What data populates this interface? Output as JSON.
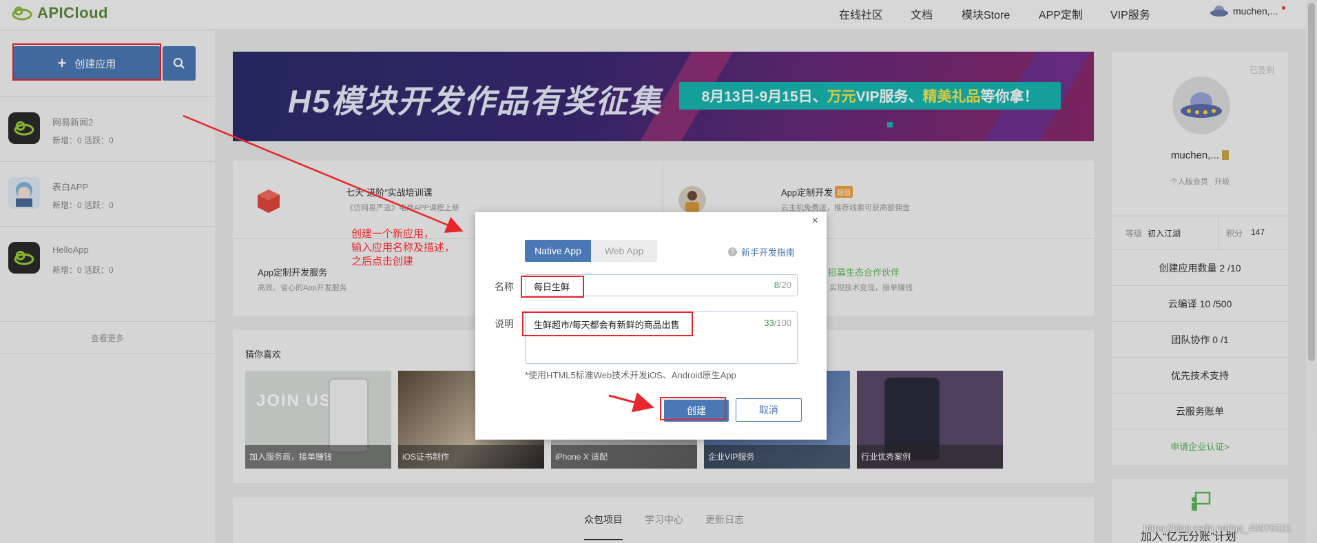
{
  "header": {
    "logo_text": "APICloud",
    "nav": [
      "在线社区",
      "文档",
      "模块Store",
      "APP定制",
      "VIP服务"
    ],
    "username": "muchen,..."
  },
  "sidebar": {
    "create_label": "创建应用",
    "apps": [
      {
        "name": "网易新闻2",
        "stats": "新增：0   活跃：0"
      },
      {
        "name": "表白APP",
        "stats": "新增：0   活跃：0"
      },
      {
        "name": "HelloApp",
        "stats": "新增：0   活跃：0"
      }
    ],
    "see_more": "查看更多"
  },
  "banner": {
    "title": "H5模块开发作品有奖征集",
    "pill_a": "8月13日-9月15日、",
    "pill_b": "万元",
    "pill_c": "VIP服务、",
    "pill_d": "精美礼品",
    "pill_e": "等你拿！"
  },
  "promos": [
    {
      "title": "七天“进阶”实战培训课",
      "sub": "《仿网易严选》电商APP课程上新"
    },
    {
      "title": "App定制开发",
      "tag": "超值",
      "sub": "云主机免费送，推荐线索可获高额佣金"
    },
    {
      "title": "App定制开发服务",
      "sub": "高效、省心的App开发服务"
    },
    {
      "title": "招募生态合作伙伴",
      "sub": "实现技术变现，接单赚钱"
    }
  ],
  "guess": {
    "label": "猜你喜欢",
    "items": [
      "加入服务商，接单赚钱",
      "iOS证书制作",
      "iPhone X 适配",
      "企业VIP服务",
      "行业优秀案例"
    ],
    "join_us": "JOIN US"
  },
  "bottom_tabs": [
    "众包项目",
    "学习中心",
    "更新日志"
  ],
  "profile": {
    "signed": "已签到",
    "name": "muchen,...",
    "edition": "个人版会员",
    "upgrade": "升级",
    "level_label": "等级",
    "level_value": "初入江湖",
    "points_label": "积分",
    "points_value": "147",
    "rows": [
      "创建应用数量 2 /10",
      "云编译 10 /500",
      "团队协作 0 /1",
      "优先技术支持",
      "云服务账单"
    ],
    "enterprise": "申请企业认证>"
  },
  "side2": {
    "join": "加入“亿元分账”计划"
  },
  "watermark": "https://blog.csdn.net/qq_40976321",
  "modal": {
    "tab_native": "Native App",
    "tab_web": "Web App",
    "guide": "新手开发指南",
    "name_label": "名称",
    "name_value": "每日生鲜",
    "name_count": "8",
    "name_max": "/20",
    "desc_label": "说明",
    "desc_value": "生鲜超市/每天都会有新鲜的商品出售",
    "desc_count": "33",
    "desc_max": "/100",
    "hint": "*使用HTML5标准Web技术开发iOS、Android原生App",
    "create_btn": "创建",
    "cancel_btn": "取消",
    "close": "×"
  },
  "annotation": {
    "line1": "创建一个新应用，",
    "line2": "输入应用名称及描述，",
    "line3": "之后点击创建"
  },
  "colors": {
    "primary": "#4a78b4",
    "highlight_red": "#e8262b",
    "green": "#5ab85a"
  }
}
